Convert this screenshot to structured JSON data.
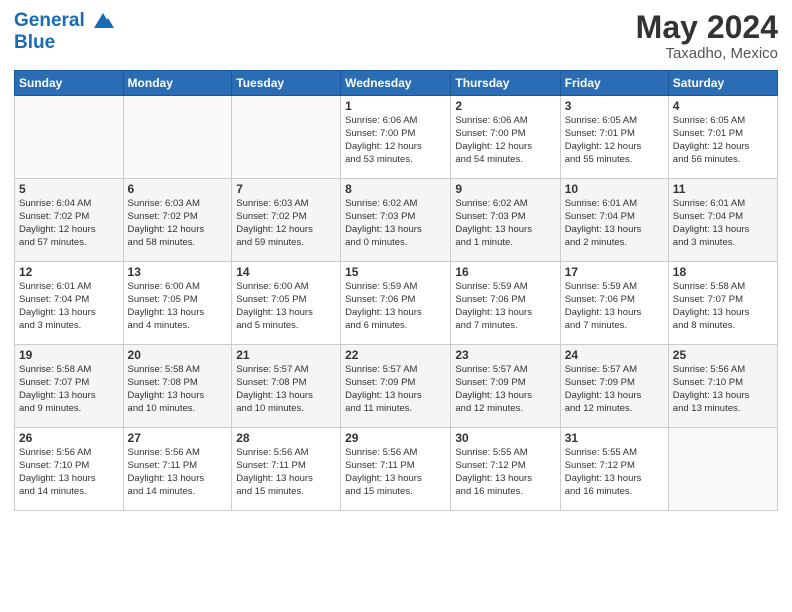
{
  "header": {
    "logo_line1": "General",
    "logo_line2": "Blue",
    "main_title": "May 2024",
    "subtitle": "Taxadho, Mexico"
  },
  "weekdays": [
    "Sunday",
    "Monday",
    "Tuesday",
    "Wednesday",
    "Thursday",
    "Friday",
    "Saturday"
  ],
  "weeks": [
    [
      {
        "day": "",
        "info": ""
      },
      {
        "day": "",
        "info": ""
      },
      {
        "day": "",
        "info": ""
      },
      {
        "day": "1",
        "info": "Sunrise: 6:06 AM\nSunset: 7:00 PM\nDaylight: 12 hours\nand 53 minutes."
      },
      {
        "day": "2",
        "info": "Sunrise: 6:06 AM\nSunset: 7:00 PM\nDaylight: 12 hours\nand 54 minutes."
      },
      {
        "day": "3",
        "info": "Sunrise: 6:05 AM\nSunset: 7:01 PM\nDaylight: 12 hours\nand 55 minutes."
      },
      {
        "day": "4",
        "info": "Sunrise: 6:05 AM\nSunset: 7:01 PM\nDaylight: 12 hours\nand 56 minutes."
      }
    ],
    [
      {
        "day": "5",
        "info": "Sunrise: 6:04 AM\nSunset: 7:02 PM\nDaylight: 12 hours\nand 57 minutes."
      },
      {
        "day": "6",
        "info": "Sunrise: 6:03 AM\nSunset: 7:02 PM\nDaylight: 12 hours\nand 58 minutes."
      },
      {
        "day": "7",
        "info": "Sunrise: 6:03 AM\nSunset: 7:02 PM\nDaylight: 12 hours\nand 59 minutes."
      },
      {
        "day": "8",
        "info": "Sunrise: 6:02 AM\nSunset: 7:03 PM\nDaylight: 13 hours\nand 0 minutes."
      },
      {
        "day": "9",
        "info": "Sunrise: 6:02 AM\nSunset: 7:03 PM\nDaylight: 13 hours\nand 1 minute."
      },
      {
        "day": "10",
        "info": "Sunrise: 6:01 AM\nSunset: 7:04 PM\nDaylight: 13 hours\nand 2 minutes."
      },
      {
        "day": "11",
        "info": "Sunrise: 6:01 AM\nSunset: 7:04 PM\nDaylight: 13 hours\nand 3 minutes."
      }
    ],
    [
      {
        "day": "12",
        "info": "Sunrise: 6:01 AM\nSunset: 7:04 PM\nDaylight: 13 hours\nand 3 minutes."
      },
      {
        "day": "13",
        "info": "Sunrise: 6:00 AM\nSunset: 7:05 PM\nDaylight: 13 hours\nand 4 minutes."
      },
      {
        "day": "14",
        "info": "Sunrise: 6:00 AM\nSunset: 7:05 PM\nDaylight: 13 hours\nand 5 minutes."
      },
      {
        "day": "15",
        "info": "Sunrise: 5:59 AM\nSunset: 7:06 PM\nDaylight: 13 hours\nand 6 minutes."
      },
      {
        "day": "16",
        "info": "Sunrise: 5:59 AM\nSunset: 7:06 PM\nDaylight: 13 hours\nand 7 minutes."
      },
      {
        "day": "17",
        "info": "Sunrise: 5:59 AM\nSunset: 7:06 PM\nDaylight: 13 hours\nand 7 minutes."
      },
      {
        "day": "18",
        "info": "Sunrise: 5:58 AM\nSunset: 7:07 PM\nDaylight: 13 hours\nand 8 minutes."
      }
    ],
    [
      {
        "day": "19",
        "info": "Sunrise: 5:58 AM\nSunset: 7:07 PM\nDaylight: 13 hours\nand 9 minutes."
      },
      {
        "day": "20",
        "info": "Sunrise: 5:58 AM\nSunset: 7:08 PM\nDaylight: 13 hours\nand 10 minutes."
      },
      {
        "day": "21",
        "info": "Sunrise: 5:57 AM\nSunset: 7:08 PM\nDaylight: 13 hours\nand 10 minutes."
      },
      {
        "day": "22",
        "info": "Sunrise: 5:57 AM\nSunset: 7:09 PM\nDaylight: 13 hours\nand 11 minutes."
      },
      {
        "day": "23",
        "info": "Sunrise: 5:57 AM\nSunset: 7:09 PM\nDaylight: 13 hours\nand 12 minutes."
      },
      {
        "day": "24",
        "info": "Sunrise: 5:57 AM\nSunset: 7:09 PM\nDaylight: 13 hours\nand 12 minutes."
      },
      {
        "day": "25",
        "info": "Sunrise: 5:56 AM\nSunset: 7:10 PM\nDaylight: 13 hours\nand 13 minutes."
      }
    ],
    [
      {
        "day": "26",
        "info": "Sunrise: 5:56 AM\nSunset: 7:10 PM\nDaylight: 13 hours\nand 14 minutes."
      },
      {
        "day": "27",
        "info": "Sunrise: 5:56 AM\nSunset: 7:11 PM\nDaylight: 13 hours\nand 14 minutes."
      },
      {
        "day": "28",
        "info": "Sunrise: 5:56 AM\nSunset: 7:11 PM\nDaylight: 13 hours\nand 15 minutes."
      },
      {
        "day": "29",
        "info": "Sunrise: 5:56 AM\nSunset: 7:11 PM\nDaylight: 13 hours\nand 15 minutes."
      },
      {
        "day": "30",
        "info": "Sunrise: 5:55 AM\nSunset: 7:12 PM\nDaylight: 13 hours\nand 16 minutes."
      },
      {
        "day": "31",
        "info": "Sunrise: 5:55 AM\nSunset: 7:12 PM\nDaylight: 13 hours\nand 16 minutes."
      },
      {
        "day": "",
        "info": ""
      }
    ]
  ]
}
